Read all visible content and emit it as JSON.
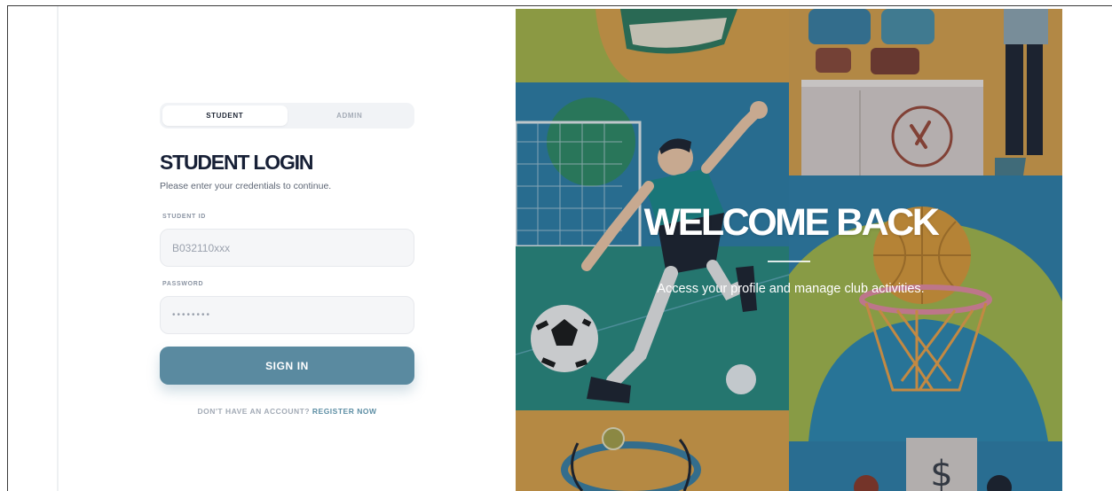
{
  "tabs": {
    "student": "STUDENT",
    "admin": "ADMIN"
  },
  "login": {
    "title": "STUDENT LOGIN",
    "subtitle": "Please enter your credentials to continue.",
    "student_id_label": "STUDENT ID",
    "student_id_placeholder": "B032110xxx",
    "password_label": "PASSWORD",
    "password_placeholder": "••••••••",
    "signin_label": "SIGN IN",
    "register_prompt": "DON'T HAVE AN ACCOUNT?",
    "register_link": "REGISTER NOW"
  },
  "hero": {
    "title": "WELCOME BACK",
    "subtitle": "Access your profile and manage club activities.",
    "tile_icons": [
      "book-icon",
      "food-stall-icon",
      "soccer-icon",
      "basketball-icon",
      "atom-icon",
      "dollar-sign-icon"
    ]
  },
  "colors": {
    "accent": "#5a8aa0",
    "title_text": "#172036",
    "tab_background": "#f1f3f6"
  }
}
